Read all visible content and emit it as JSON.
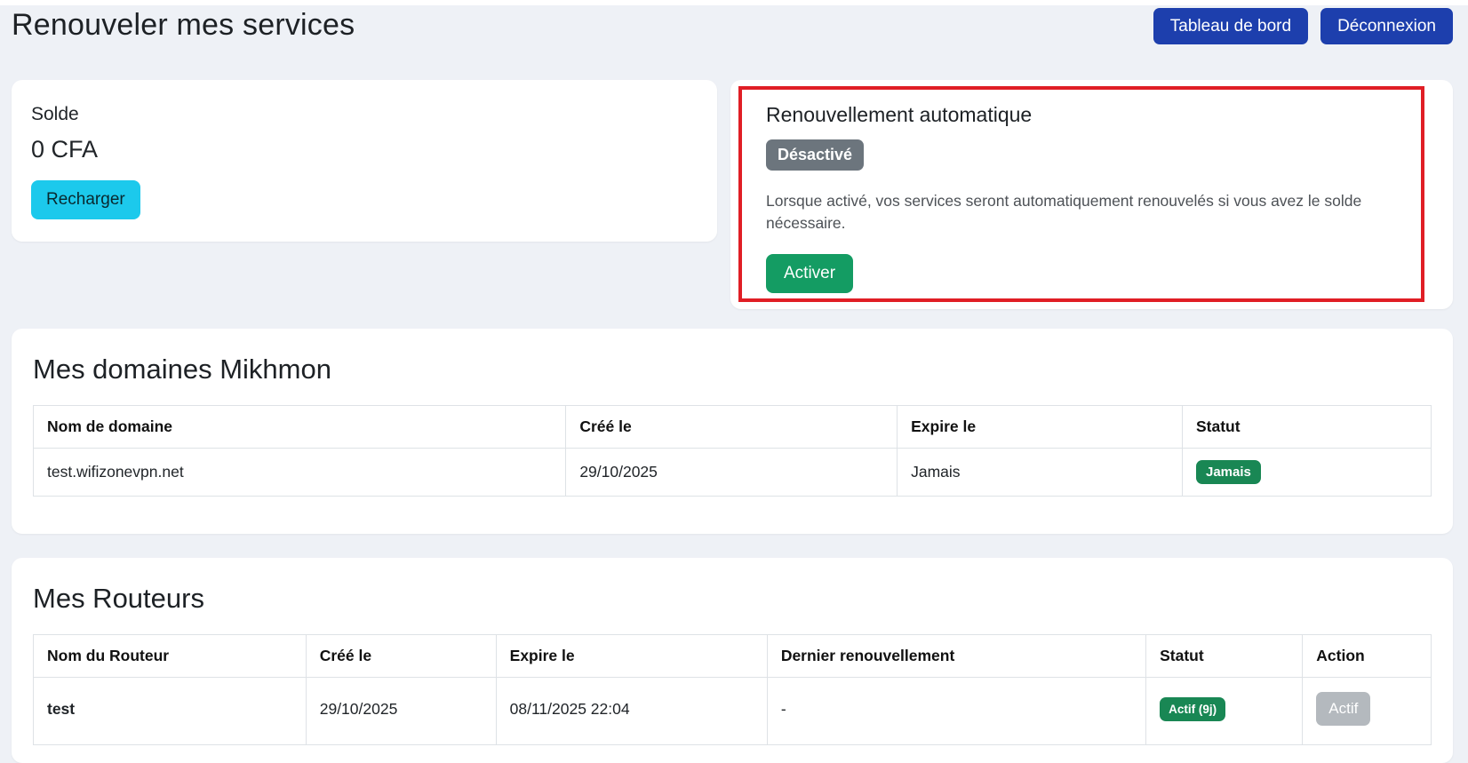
{
  "page": {
    "title": "Renouveler mes services"
  },
  "header": {
    "buttons": [
      {
        "label": "Tableau de bord"
      },
      {
        "label": "Déconnexion"
      }
    ]
  },
  "balance_card": {
    "title": "Solde",
    "amount": "0 CFA",
    "recharge_label": "Recharger"
  },
  "auto_renewal_card": {
    "title": "Renouvellement automatique",
    "status_badge": "Désactivé",
    "description": "Lorsque activé, vos services seront automatiquement renouvelés si vous avez le solde nécessaire.",
    "activate_label": "Activer",
    "highlight_color": "#e01e25"
  },
  "domains_section": {
    "title": "Mes domaines Mikhmon",
    "columns": [
      "Nom de domaine",
      "Créé le",
      "Expire le",
      "Statut"
    ],
    "rows": [
      {
        "domain": "test.wifizonevpn.net",
        "created": "29/10/2025",
        "expires": "Jamais",
        "status": "Jamais"
      }
    ]
  },
  "routers_section": {
    "title": "Mes Routeurs",
    "columns": [
      "Nom du Routeur",
      "Créé le",
      "Expire le",
      "Dernier renouvellement",
      "Statut",
      "Action"
    ],
    "rows": [
      {
        "name": "test",
        "created": "29/10/2025",
        "expires": "08/11/2025 22:04",
        "last_renewal": "-",
        "status": "Actif (9j)",
        "action": "Actif"
      }
    ]
  },
  "colors": {
    "page_background": "#eef1f6",
    "primary_button": "#1d3fad",
    "recharge_button": "#1cc9ec",
    "activate_button": "#149c63",
    "success_badge": "#198754",
    "disabled_badge": "#6c757d",
    "muted_action_button": "#b4b9be",
    "highlight_border": "#e01e25",
    "table_border": "#dee2e6"
  }
}
